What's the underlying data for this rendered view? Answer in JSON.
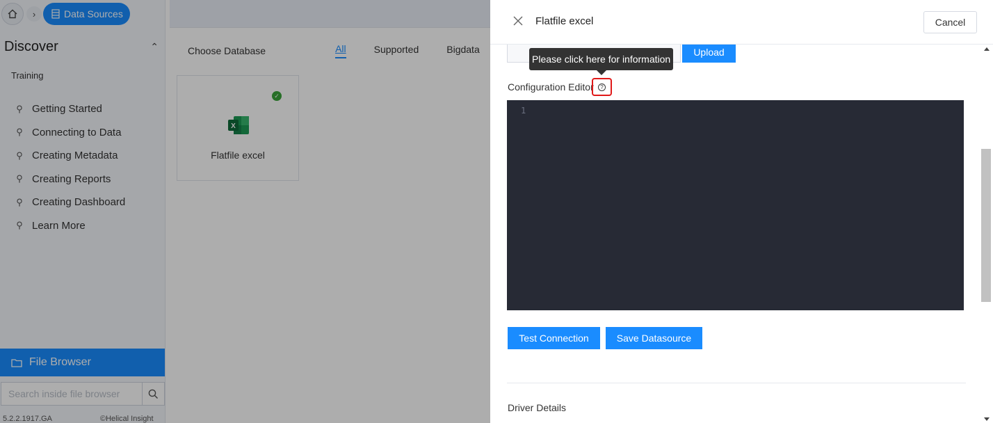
{
  "breadcrumb": {
    "home_icon": "home-icon",
    "separator_icon": "chevron-right-icon",
    "current": "Data Sources",
    "current_icon": "database-icon"
  },
  "sidebar": {
    "section_title": "Discover",
    "section_toggle_icon": "chevron-up-icon",
    "subtitle": "Training",
    "items": [
      {
        "label": "Getting Started",
        "icon": "bulb-icon"
      },
      {
        "label": "Connecting to Data",
        "icon": "bulb-icon"
      },
      {
        "label": "Creating Metadata",
        "icon": "bulb-icon"
      },
      {
        "label": "Creating Reports",
        "icon": "bulb-icon"
      },
      {
        "label": "Creating Dashboard",
        "icon": "bulb-icon"
      },
      {
        "label": "Learn More",
        "icon": "bulb-icon"
      }
    ],
    "file_browser": {
      "label": "File Browser",
      "icon": "folder-icon"
    },
    "search": {
      "placeholder": "Search inside file browser",
      "icon": "search-icon"
    },
    "version": "5.2.2.1917.GA",
    "copyright": "Helical Insight"
  },
  "main": {
    "choose_label": "Choose Database",
    "tabs": [
      {
        "label": "All",
        "active": true
      },
      {
        "label": "Supported",
        "active": false
      },
      {
        "label": "Bigdata",
        "active": false
      }
    ],
    "cards": [
      {
        "label": "Flatfile excel",
        "icon": "excel-icon",
        "status_icon": "check-circle-icon"
      }
    ]
  },
  "panel": {
    "title": "Flatfile excel",
    "close_icon": "close-icon",
    "cancel_label": "Cancel",
    "upload_label": "Upload",
    "tooltip": "Please click here for information",
    "config_label": "Configuration Editor",
    "help_icon": "question-circle-icon",
    "editor": {
      "line_numbers": [
        "1"
      ],
      "content": ""
    },
    "test_label": "Test Connection",
    "save_label": "Save Datasource",
    "driver_details_label": "Driver Details"
  },
  "colors": {
    "accent": "#1a8cff",
    "editor_bg": "#272a35",
    "highlight_border": "#e01919",
    "tooltip_bg": "#333333",
    "success": "#3aa43a"
  }
}
